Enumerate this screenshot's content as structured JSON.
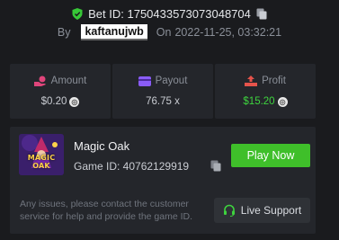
{
  "header": {
    "bet_label": "Bet ID: 1750433573073048704",
    "by_label": "By",
    "username": "kaftanujwb",
    "on_label": "On",
    "date": "2022-11-25, 03:32:21"
  },
  "stats": [
    {
      "label": "Amount",
      "value": "$0.20",
      "icon": "amount-icon",
      "color": "#e0457b"
    },
    {
      "label": "Payout",
      "value": "76.75 x",
      "icon": "payout-icon",
      "color": "#8a5cf6"
    },
    {
      "label": "Profit",
      "value": "$15.20",
      "icon": "profit-icon",
      "color": "#e5534b"
    }
  ],
  "game": {
    "thumbnail_text": "MAGIC OAK",
    "title": "Magic Oak",
    "id_label": "Game ID: 40762129919",
    "play_label": "Play Now"
  },
  "support": {
    "message": "Any issues, please contact the customer service for help and provide the game ID.",
    "button_label": "Live Support"
  },
  "colors": {
    "accent": "#3fbf2a",
    "background": "#1a1b1e",
    "card": "#24262b"
  }
}
